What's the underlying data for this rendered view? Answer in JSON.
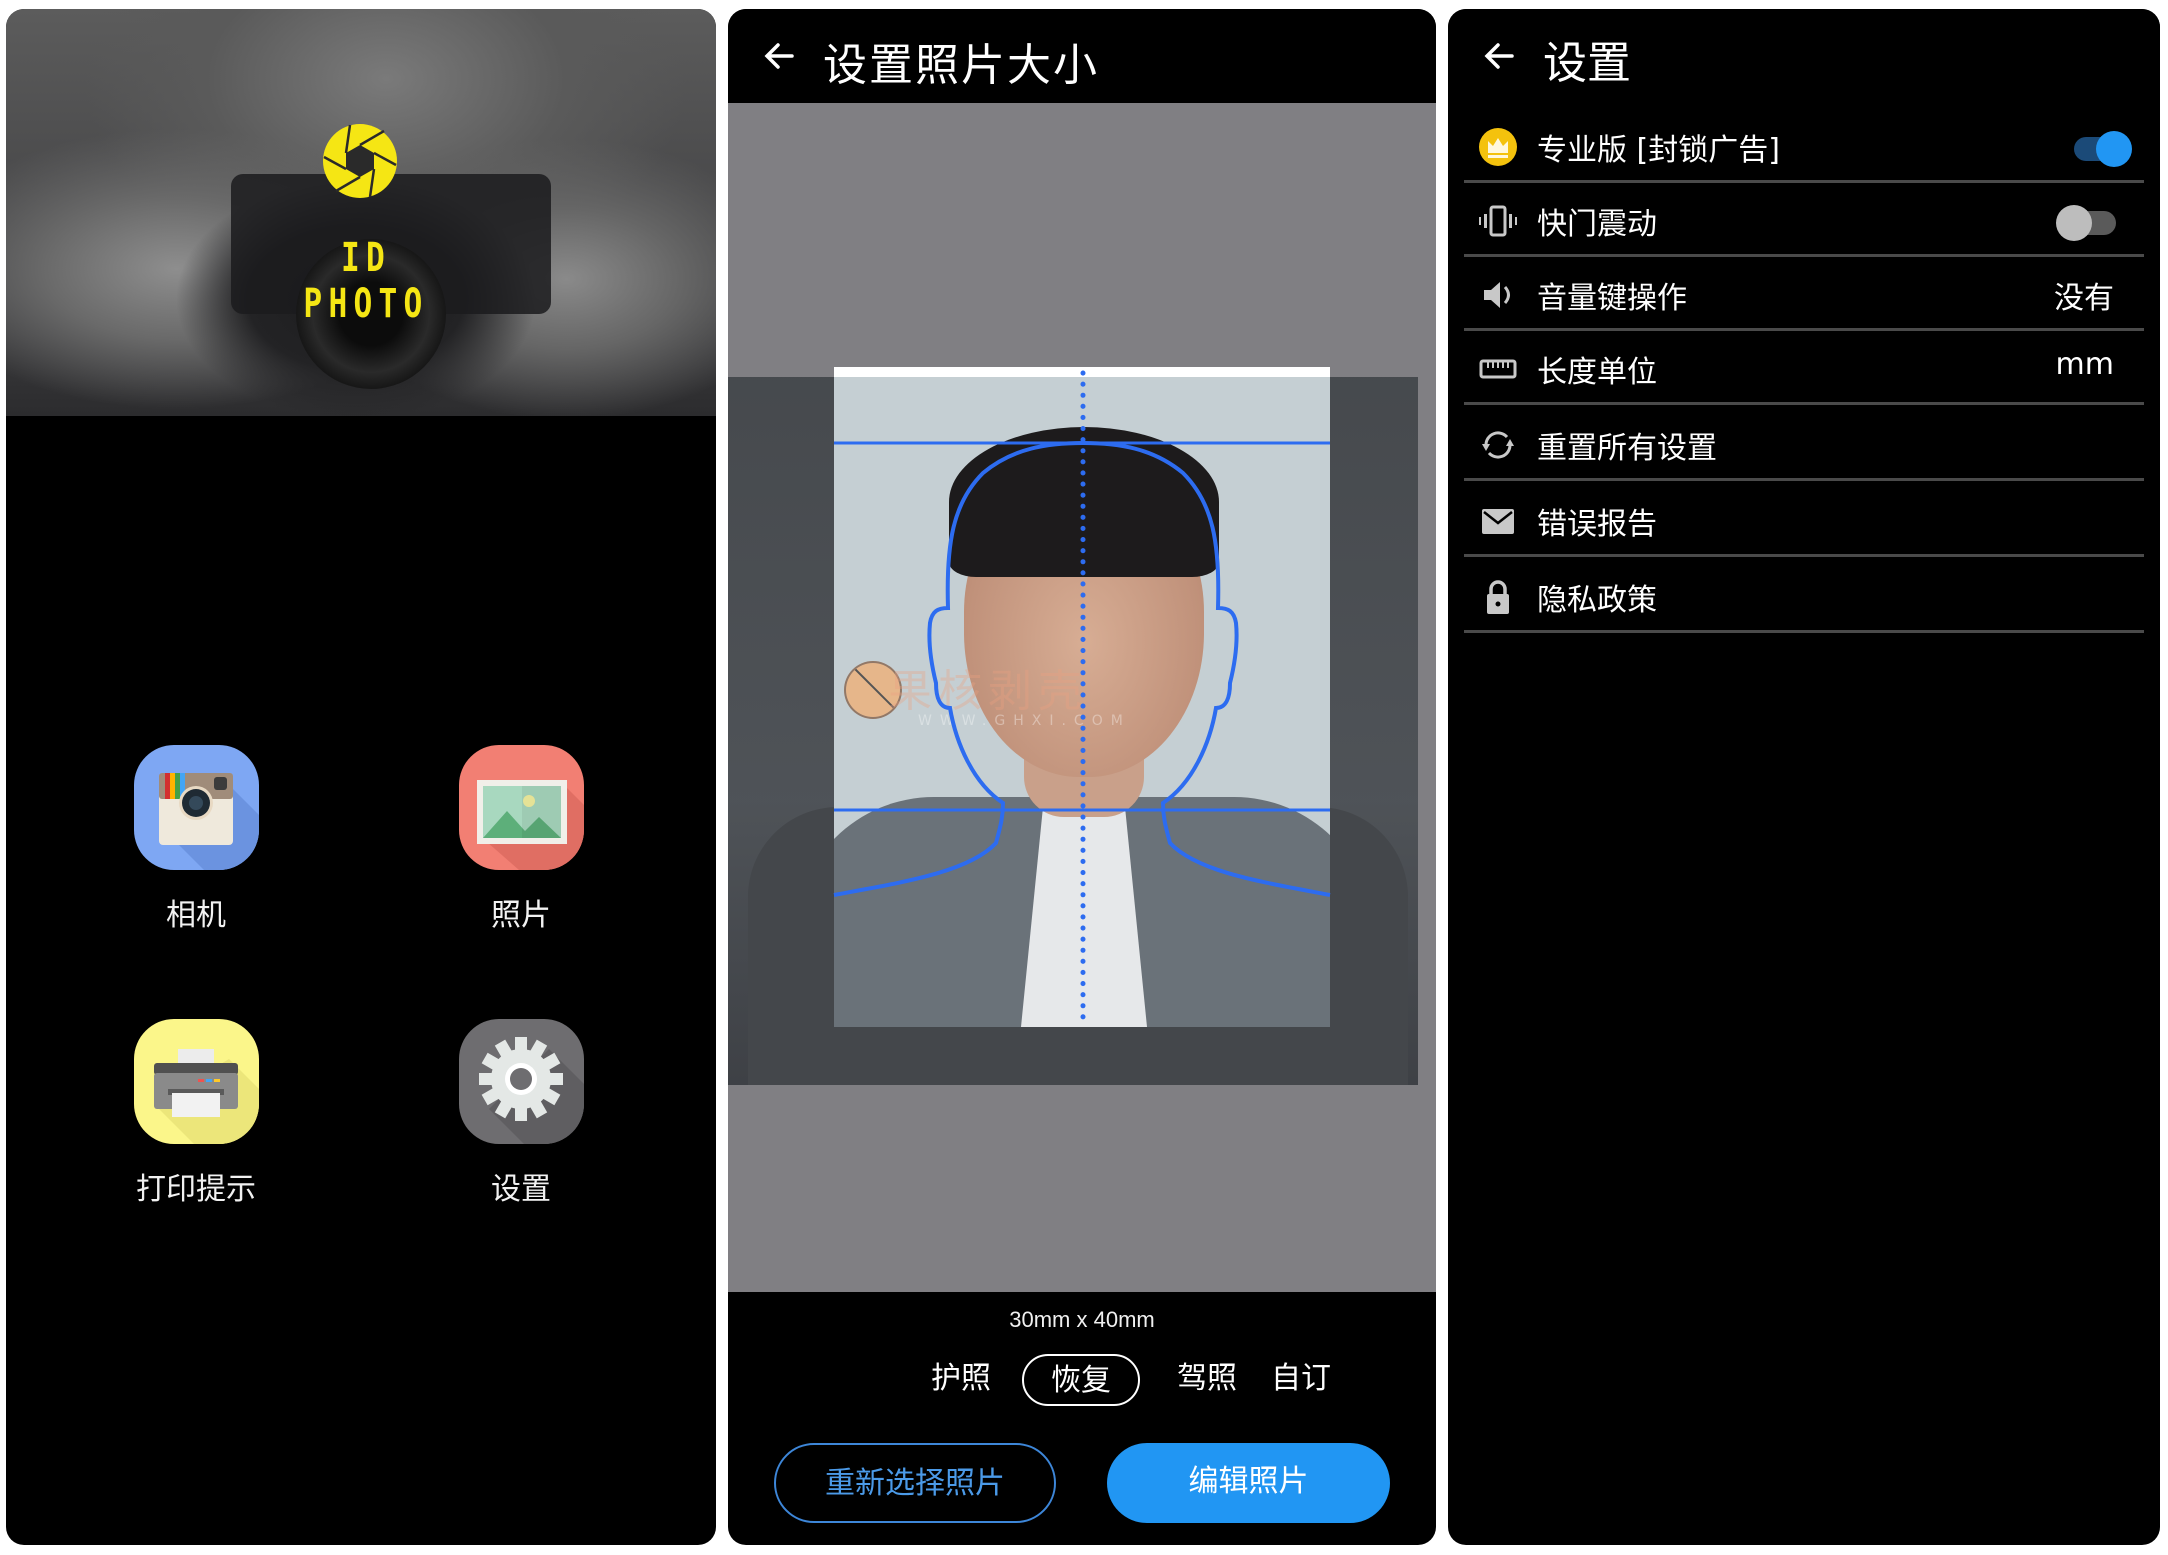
{
  "home": {
    "app_name": "ID PHOTO",
    "tiles": [
      {
        "label": "相机",
        "icon": "camera-icon",
        "color": "#7ea7f3"
      },
      {
        "label": "照片",
        "icon": "gallery-icon",
        "color": "#f27f73"
      },
      {
        "label": "打印提示",
        "icon": "printer-icon",
        "color": "#fbf68a"
      },
      {
        "label": "设置",
        "icon": "gear-icon",
        "color": "#6e6d70"
      }
    ],
    "logo_color": "#f5e614"
  },
  "photo_size": {
    "title": "设置照片大小",
    "size_text": "30mm x 40mm",
    "presets": [
      {
        "label": "护照",
        "active": false
      },
      {
        "label": "恢复",
        "active": true
      },
      {
        "label": "驾照",
        "active": false
      },
      {
        "label": "自订",
        "active": false
      }
    ],
    "reselect_button": "重新选择照片",
    "edit_button": "编辑照片",
    "watermark": "果核剥壳",
    "watermark_url": "WWW.GHXI.COM",
    "accent_color": "#2196f3",
    "guide_color": "#2d6cf0"
  },
  "settings": {
    "title": "设置",
    "rows": [
      {
        "label": "专业版 [封锁广告]",
        "icon": "crown-icon",
        "type": "toggle",
        "on": true
      },
      {
        "label": "快门震动",
        "icon": "vibrate-icon",
        "type": "toggle",
        "on": false
      },
      {
        "label": "音量键操作",
        "icon": "volume-icon",
        "type": "value",
        "value": "没有"
      },
      {
        "label": "长度单位",
        "icon": "ruler-icon",
        "type": "value",
        "value": "mm"
      },
      {
        "label": "重置所有设置",
        "icon": "reset-icon",
        "type": "action"
      },
      {
        "label": "错误报告",
        "icon": "mail-icon",
        "type": "action"
      },
      {
        "label": "隐私政策",
        "icon": "lock-icon",
        "type": "action"
      }
    ]
  }
}
